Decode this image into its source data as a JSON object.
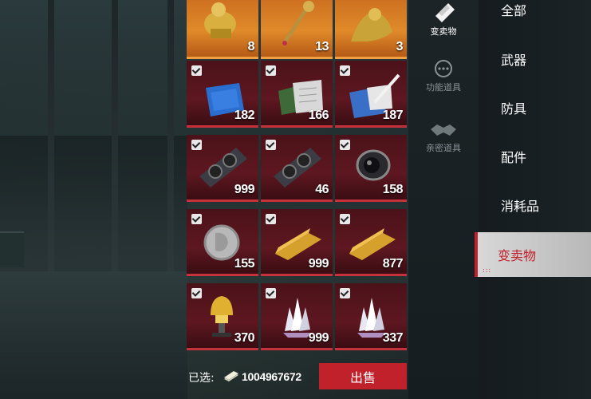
{
  "items": [
    {
      "qty": "8",
      "icon": "golden-trophy-icon",
      "style": "gold",
      "checked": false
    },
    {
      "qty": "13",
      "icon": "golden-scepter-icon",
      "style": "gold",
      "checked": false
    },
    {
      "qty": "3",
      "icon": "golden-statue-icon",
      "style": "gold",
      "checked": false
    },
    {
      "qty": "182",
      "icon": "blue-blueprint-icon",
      "style": "red",
      "checked": true
    },
    {
      "qty": "166",
      "icon": "circuit-board-docs-icon",
      "style": "red",
      "checked": true
    },
    {
      "qty": "187",
      "icon": "blueprint-with-pen-icon",
      "style": "red",
      "checked": true
    },
    {
      "qty": "999",
      "icon": "graphics-card-icon",
      "style": "red",
      "checked": true
    },
    {
      "qty": "46",
      "icon": "graphics-card-icon",
      "style": "red",
      "checked": true
    },
    {
      "qty": "158",
      "icon": "camera-lens-icon",
      "style": "red",
      "checked": true
    },
    {
      "qty": "155",
      "icon": "silver-coin-icon",
      "style": "red",
      "checked": true
    },
    {
      "qty": "999",
      "icon": "gold-bar-icon",
      "style": "red",
      "checked": true
    },
    {
      "qty": "877",
      "icon": "gold-bar-icon",
      "style": "red",
      "checked": true
    },
    {
      "qty": "370",
      "icon": "golden-helmet-icon",
      "style": "red",
      "checked": true
    },
    {
      "qty": "999",
      "icon": "crystal-cluster-icon",
      "style": "red",
      "checked": true
    },
    {
      "qty": "337",
      "icon": "crystal-cluster-icon",
      "style": "red",
      "checked": true
    }
  ],
  "footer": {
    "selected_label": "已选:",
    "selected_value": "1004967672",
    "money_icon": "cash-icon",
    "sell_label": "出售"
  },
  "subcategories": [
    {
      "label": "变卖物",
      "icon": "sell-items-icon",
      "active": true
    },
    {
      "label": "功能道具",
      "icon": "function-tools-icon",
      "active": false
    },
    {
      "label": "亲密道具",
      "icon": "handshake-icon",
      "active": false
    }
  ],
  "categories": [
    {
      "label": "全部",
      "active": false
    },
    {
      "label": "武器",
      "active": false
    },
    {
      "label": "防具",
      "active": false
    },
    {
      "label": "配件",
      "active": false
    },
    {
      "label": "消耗品",
      "active": false
    },
    {
      "label": "变卖物",
      "active": true
    }
  ],
  "colors": {
    "accent": "#c1212b",
    "tile_red": "#5e1720",
    "tile_gold": "#e08a2a"
  }
}
